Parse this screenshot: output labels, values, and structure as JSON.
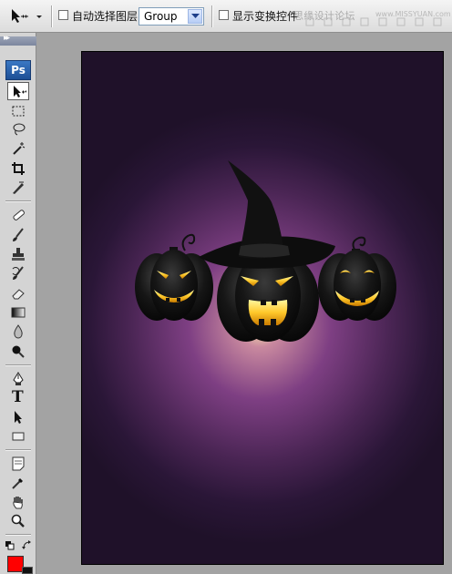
{
  "options_bar": {
    "auto_select_label": "自动选择图层",
    "auto_select_value": "Group",
    "show_transform_label": "显示变换控件",
    "watermark_text": "思缘设计论坛",
    "watermark_url": "www.MISSYUAN.com"
  },
  "toolbox": {
    "logo": "Ps",
    "tools": [
      "move-tool",
      "marquee-tool",
      "lasso-tool",
      "magic-wand-tool",
      "crop-tool",
      "slice-tool",
      "healing-brush-tool",
      "brush-tool",
      "clone-stamp-tool",
      "history-brush-tool",
      "eraser-tool",
      "gradient-tool",
      "blur-tool",
      "dodge-tool",
      "pen-tool",
      "type-tool",
      "path-selection-tool",
      "rectangle-tool",
      "notes-tool",
      "eyedropper-tool",
      "hand-tool",
      "zoom-tool"
    ],
    "type_tool_glyph": "T",
    "foreground_color": "#ff0000",
    "background_color": "#111111"
  },
  "canvas": {
    "background_colors": [
      "#1f1129",
      "#4a2554",
      "#7e3f83",
      "#fff3b0"
    ],
    "pumpkin_color": "#111111",
    "face_glow_color": "#ffd23a",
    "hat_color": "#0d0d0d"
  }
}
